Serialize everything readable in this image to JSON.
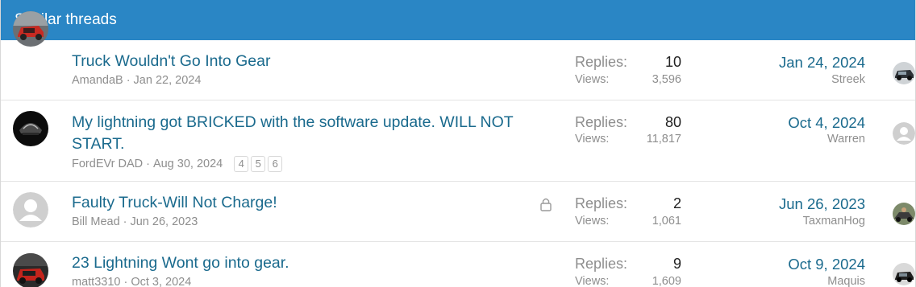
{
  "header": {
    "title": "Similar threads"
  },
  "threads": [
    {
      "title": "Truck Wouldn't Go Into Gear",
      "author": "AmandaB",
      "date": "Jan 22, 2024",
      "replies_label": "Replies:",
      "replies": "10",
      "views_label": "Views:",
      "views": "3,596",
      "last_date": "Jan 24, 2024",
      "last_user": "Streek"
    },
    {
      "title_line1": "My lightning got BRICKED with the software update. WILL NOT",
      "title_line2": "START.",
      "author": "FordEVr DAD",
      "date": "Aug 30, 2024",
      "pages": [
        "4",
        "5",
        "6"
      ],
      "replies_label": "Replies:",
      "replies": "80",
      "views_label": "Views:",
      "views": "11,817",
      "last_date": "Oct 4, 2024",
      "last_user": "Warren"
    },
    {
      "title": "Faulty Truck-Will Not Charge!",
      "author": "Bill Mead",
      "date": "Jun 26, 2023",
      "locked": true,
      "replies_label": "Replies:",
      "replies": "2",
      "views_label": "Views:",
      "views": "1,061",
      "last_date": "Jun 26, 2023",
      "last_user": "TaxmanHog"
    },
    {
      "title": "23 Lightning Wont go into gear.",
      "author": "matt3310",
      "date": "Oct 3, 2024",
      "replies_label": "Replies:",
      "replies": "9",
      "views_label": "Views:",
      "views": "1,609",
      "last_date": "Oct 9, 2024",
      "last_user": "Maquis"
    }
  ],
  "meta_separator": "·",
  "colors": {
    "header_bg": "#2a86c5",
    "link": "#1a6a8d",
    "muted": "#8e8e8e"
  }
}
